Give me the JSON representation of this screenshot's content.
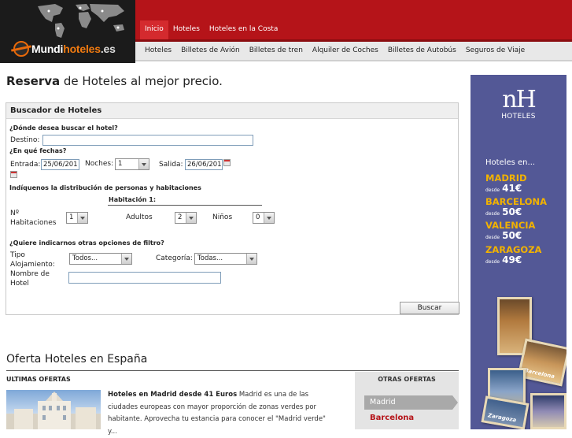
{
  "brand": {
    "logo_main": "Mundi",
    "logo_accent": "hoteles",
    "logo_tld": ".es"
  },
  "topnav": [
    "Inicio",
    "Hoteles",
    "Hoteles en la Costa"
  ],
  "subnav": [
    "Hoteles",
    "Billetes de Avión",
    "Billetes de tren",
    "Alquiler de Coches",
    "Billetes de Autobús",
    "Seguros de Viaje"
  ],
  "page": {
    "title_bold": "Reserva",
    "title_rest": " de Hoteles al mejor precio."
  },
  "search": {
    "header": "Buscador de Hoteles",
    "q_where": "¿Dónde desea buscar el hotel?",
    "destino_label": "Destino:",
    "destino_value": "",
    "q_dates": "¿En qué fechas?",
    "entrada_label": "Entrada:",
    "entrada_value": "25/06/201",
    "noches_label": "Noches:",
    "noches_value": "1",
    "salida_label": "Salida:",
    "salida_value": "26/06/201",
    "q_distribution": "Indíquenos la distribución de personas y habitaciones",
    "habitacion_heading": "Habitación 1:",
    "num_hab_label": "Nº Habitaciones",
    "num_hab_value": "1",
    "adultos_label": "Adultos",
    "adultos_value": "2",
    "ninos_label": "Niños",
    "ninos_value": "0",
    "q_filters": "¿Quiere indicarnos otras opciones de filtro?",
    "tipo_label": "Tipo Alojamiento:",
    "tipo_value": "Todos...",
    "categoria_label": "Categoría:",
    "categoria_value": "Todas...",
    "nombre_label": "Nombre de Hotel",
    "nombre_value": "",
    "submit_label": "Buscar"
  },
  "offers": {
    "title": "Oferta Hoteles en España",
    "latest_label": "ULTIMAS OFERTAS",
    "item_title": "Hoteles en Madrid desde 41 Euros",
    "item_text": " Madrid es una de las ciudades europeas con mayor proporción de zonas verdes por habitante. Aprovecha tu estancia para conocer el \"Madrid verde\" y...",
    "other_label": "OTRAS OFERTAS",
    "other_items": [
      "Madrid",
      "Barcelona"
    ]
  },
  "ad": {
    "logo": "nH",
    "logo_sub": "HOTELES",
    "intro": "Hoteles en...",
    "desde": "desde",
    "cities": [
      {
        "name": "MADRID",
        "price": "41€"
      },
      {
        "name": "BARCELONA",
        "price": "50€"
      },
      {
        "name": "VALENCIA",
        "price": "50€"
      },
      {
        "name": "ZARAGOZA",
        "price": "49€"
      }
    ],
    "card_labels": [
      "Barcelona",
      "Zaragoza"
    ],
    "colors": {
      "background": "#535896",
      "city": "#f2b200"
    }
  },
  "colors": {
    "brand_red": "#b51419",
    "brand_orange": "#f07a10"
  }
}
